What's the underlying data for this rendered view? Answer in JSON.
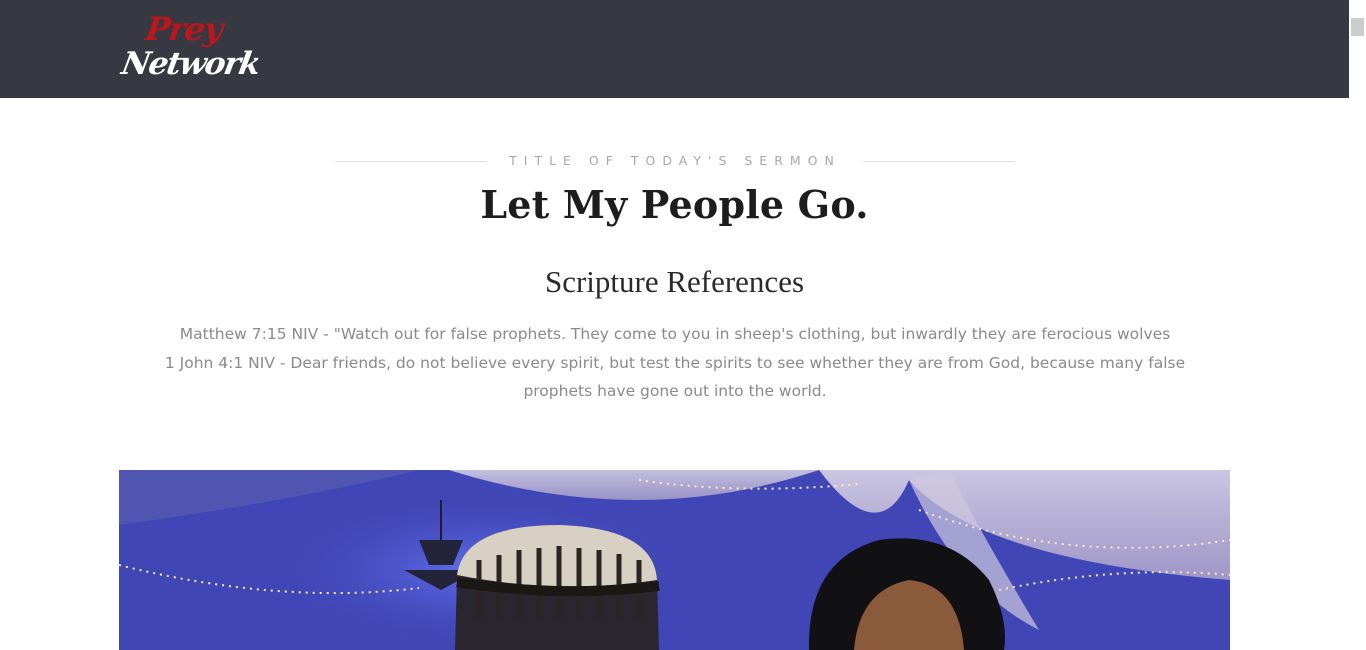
{
  "header": {
    "logo_top": "Prey",
    "logo_bottom": "Network"
  },
  "sermon": {
    "kicker": "TITLE OF TODAY'S SERMON",
    "title": "Let My People Go.",
    "references_heading": "Scripture References",
    "references": [
      "Matthew 7:15 NIV - \"Watch out for false prophets. They come to you in sheep's clothing, but inwardly they are ferocious wolves",
      "1 John 4:1 NIV - Dear friends, do not believe every spirit, but test the spirits to see whether they are from God, because many false prophets have gone out into the world."
    ]
  },
  "colors": {
    "header_bg": "#363941",
    "logo_red": "#c0141b",
    "photo_blue": "#3f45b8"
  }
}
